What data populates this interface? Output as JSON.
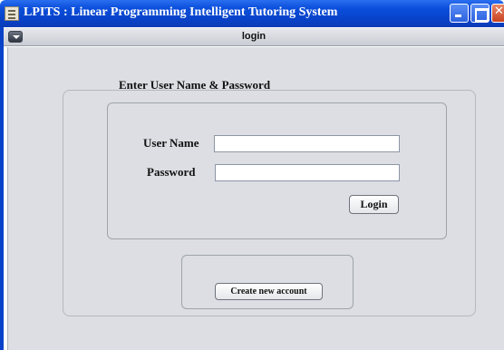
{
  "window": {
    "title": "LPITS : Linear Programming Intelligent Tutoring System",
    "accent_color": "#0842c9"
  },
  "internal_frame": {
    "title": "login"
  },
  "form": {
    "section_title": "Enter User Name & Password",
    "username_label": "User Name",
    "username_value": "",
    "password_label": "Password",
    "password_value": "",
    "login_label": "Login",
    "create_account_label": "Create new account"
  }
}
